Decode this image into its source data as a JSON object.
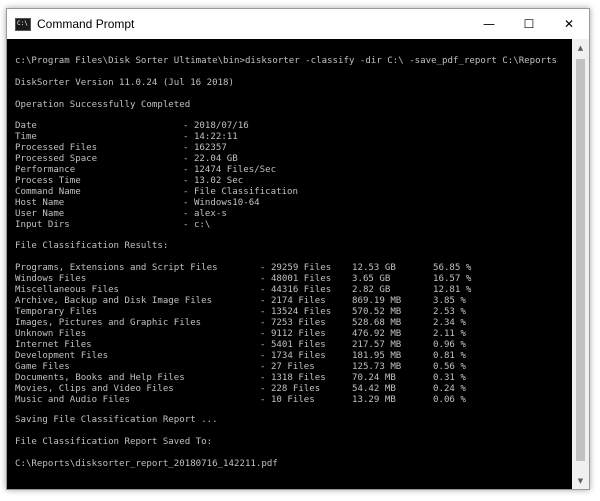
{
  "window": {
    "title": "Command Prompt",
    "icon": "cmd-icon",
    "controls": {
      "minimize": "—",
      "maximize": "☐",
      "close": "✕"
    }
  },
  "console": {
    "command": "c:\\Program Files\\Disk Sorter Ultimate\\bin>disksorter -classify -dir C:\\ -save_pdf_report C:\\Reports",
    "version": "DiskSorter Version 11.0.24 (Jul 16 2018)",
    "status": "Operation Successfully Completed",
    "info": [
      {
        "label": "Date",
        "value": "- 2018/07/16"
      },
      {
        "label": "Time",
        "value": "- 14:22:11"
      },
      {
        "label": "Processed Files",
        "value": "- 162357"
      },
      {
        "label": "Processed Space",
        "value": "- 22.04 GB"
      },
      {
        "label": "Performance",
        "value": "- 12474 Files/Sec"
      },
      {
        "label": "Process Time",
        "value": "- 13.02 Sec"
      },
      {
        "label": "Command Name",
        "value": "- File Classification"
      },
      {
        "label": "Host Name",
        "value": "- Windows10-64"
      },
      {
        "label": "User Name",
        "value": "- alex-s"
      },
      {
        "label": "Input Dirs",
        "value": "- c:\\"
      }
    ],
    "results_header": "File Classification Results:",
    "results": [
      {
        "category": "Programs, Extensions and Script Files",
        "files": "- 29259 Files",
        "size": "12.53 GB",
        "percent": "56.85 %"
      },
      {
        "category": "Windows Files",
        "files": "- 48001 Files",
        "size": "3.65 GB",
        "percent": "16.57 %"
      },
      {
        "category": "Miscellaneous Files",
        "files": "- 44316 Files",
        "size": "2.82 GB",
        "percent": "12.81 %"
      },
      {
        "category": "Archive, Backup and Disk Image Files",
        "files": "- 2174 Files",
        "size": "869.19 MB",
        "percent": "3.85 %"
      },
      {
        "category": "Temporary Files",
        "files": "- 13524 Files",
        "size": "570.52 MB",
        "percent": "2.53 %"
      },
      {
        "category": "Images, Pictures and Graphic Files",
        "files": "- 7253 Files",
        "size": "528.68 MB",
        "percent": "2.34 %"
      },
      {
        "category": "Unknown Files",
        "files": "- 9112 Files",
        "size": "476.92 MB",
        "percent": "2.11 %"
      },
      {
        "category": "Internet Files",
        "files": "- 5401 Files",
        "size": "217.57 MB",
        "percent": "0.96 %"
      },
      {
        "category": "Development Files",
        "files": "- 1734 Files",
        "size": "181.95 MB",
        "percent": "0.81 %"
      },
      {
        "category": "Game Files",
        "files": "- 27 Files",
        "size": "125.73 MB",
        "percent": "0.56 %"
      },
      {
        "category": "Documents, Books and Help Files",
        "files": "- 1318 Files",
        "size": "70.24 MB",
        "percent": "0.31 %"
      },
      {
        "category": "Movies, Clips and Video Files",
        "files": "- 228 Files",
        "size": "54.42 MB",
        "percent": "0.24 %"
      },
      {
        "category": "Music and Audio Files",
        "files": "- 10 Files",
        "size": "13.29 MB",
        "percent": "0.06 %"
      }
    ],
    "saving": "Saving File Classification Report ...",
    "saved": "File Classification Report Saved To:",
    "report_path": "C:\\Reports\\disksorter_report_20180716_142211.pdf"
  },
  "scrollbar": {
    "up_icon": "▲",
    "down_icon": "▼"
  }
}
